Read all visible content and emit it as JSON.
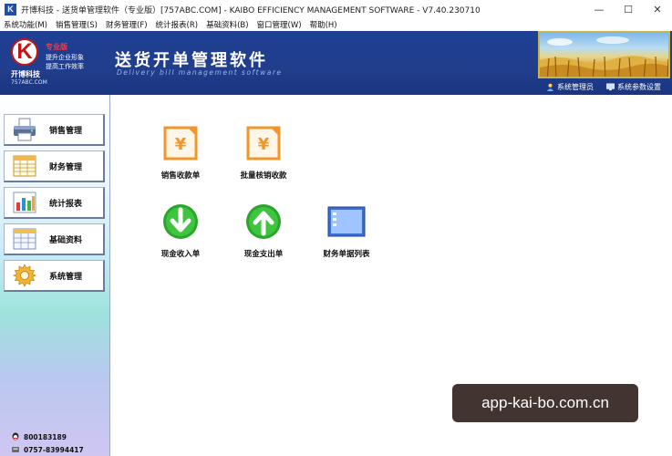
{
  "window": {
    "title": "开博科技 - 送货单管理软件（专业版）[757ABC.COM] - KAIBO EFFICIENCY MANAGEMENT SOFTWARE - V7.40.230710",
    "app_icon_letter": "K",
    "minimize_glyph": "—",
    "maximize_glyph": "☐",
    "close_glyph": "✕"
  },
  "menu": [
    {
      "label": "系统功能(M)"
    },
    {
      "label": "销售管理(S)"
    },
    {
      "label": "财务管理(F)"
    },
    {
      "label": "统计报表(R)"
    },
    {
      "label": "基础资料(B)"
    },
    {
      "label": "窗口管理(W)"
    },
    {
      "label": "帮助(H)"
    }
  ],
  "header": {
    "logo_letter": "K",
    "edition": "专业版",
    "slogan_line1": "提升企业形象",
    "slogan_line2": "提高工作效率",
    "brand": "开博科技",
    "domain": "757ABC.COM",
    "title": "送货开单管理软件",
    "subtitle": "Delivery bill management software",
    "links": [
      {
        "label": "系统管理员",
        "icon": "user-icon"
      },
      {
        "label": "系统参数设置",
        "icon": "monitor-icon"
      }
    ]
  },
  "sidebar": {
    "items": [
      {
        "label": "销售管理",
        "icon": "printer-icon"
      },
      {
        "label": "财务管理",
        "icon": "spreadsheet-icon"
      },
      {
        "label": "统计报表",
        "icon": "bar-chart-icon"
      },
      {
        "label": "基础资料",
        "icon": "table-icon"
      },
      {
        "label": "系统管理",
        "icon": "gear-icon"
      }
    ],
    "contacts": [
      {
        "label": "800183189",
        "icon": "qq-icon"
      },
      {
        "label": "0757-83994417",
        "icon": "phone-icon"
      }
    ]
  },
  "main": {
    "tiles": [
      {
        "label": "销售收款单",
        "icon": "yen-document-icon"
      },
      {
        "label": "批量核销收款",
        "icon": "yen-document-icon"
      },
      {
        "label": "现金收入单",
        "icon": "arrow-down-icon"
      },
      {
        "label": "现金支出单",
        "icon": "arrow-up-icon"
      },
      {
        "label": "财务单据列表",
        "icon": "list-window-icon"
      }
    ]
  },
  "watermark": "app-kai-bo.com.cn",
  "colors": {
    "header_blue": "#213e8c",
    "accent_orange": "#f0962a",
    "accent_green": "#2aa62a"
  }
}
